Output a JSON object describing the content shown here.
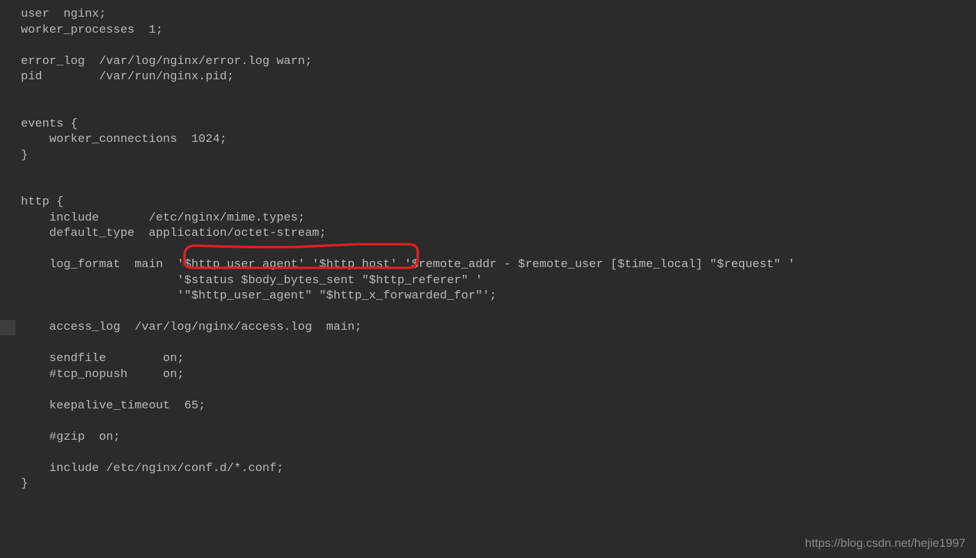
{
  "code": {
    "lines": [
      "user  nginx;",
      "worker_processes  1;",
      "",
      "error_log  /var/log/nginx/error.log warn;",
      "pid        /var/run/nginx.pid;",
      "",
      "",
      "events {",
      "    worker_connections  1024;",
      "}",
      "",
      "",
      "http {",
      "    include       /etc/nginx/mime.types;",
      "    default_type  application/octet-stream;",
      "",
      "    log_format  main  '$http_user_agent' '$http_host' '$remote_addr - $remote_user [$time_local] \"$request\" '",
      "                      '$status $body_bytes_sent \"$http_referer\" '",
      "                      '\"$http_user_agent\" \"$http_x_forwarded_for\"';",
      "",
      "    access_log  /var/log/nginx/access.log  main;",
      "",
      "    sendfile        on;",
      "    #tcp_nopush     on;",
      "",
      "    keepalive_timeout  65;",
      "",
      "    #gzip  on;",
      "",
      "    include /etc/nginx/conf.d/*.conf;",
      "}"
    ]
  },
  "watermark": "https://blog.csdn.net/hejie1997",
  "highlightLineIndex": 20
}
